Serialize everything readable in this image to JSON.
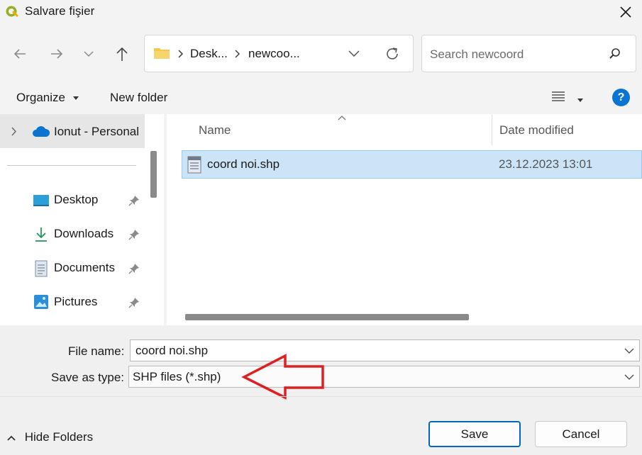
{
  "window": {
    "title": "Salvare fişier"
  },
  "nav": {
    "breadcrumb": [
      "Desk...",
      "newcoo..."
    ],
    "search_placeholder": "Search newcoord"
  },
  "toolbar": {
    "organize": "Organize",
    "new_folder": "New folder"
  },
  "sidebar": {
    "onedrive": "Ionut - Personal",
    "items": [
      {
        "label": "Desktop"
      },
      {
        "label": "Downloads"
      },
      {
        "label": "Documents"
      },
      {
        "label": "Pictures"
      }
    ]
  },
  "file_list": {
    "columns": [
      "Name",
      "Date modified"
    ],
    "rows": [
      {
        "name": "coord noi.shp",
        "date_modified": "23.12.2023 13:01"
      }
    ]
  },
  "form": {
    "file_name_label": "File name:",
    "file_name_value": "coord noi.shp",
    "save_type_label": "Save as type:",
    "save_type_value": "SHP files (*.shp)"
  },
  "footer": {
    "hide_folders": "Hide Folders",
    "save": "Save",
    "cancel": "Cancel"
  },
  "colors": {
    "selection": "#cce4f7",
    "accent": "#0067c0",
    "annotation_arrow": "#e02020"
  }
}
